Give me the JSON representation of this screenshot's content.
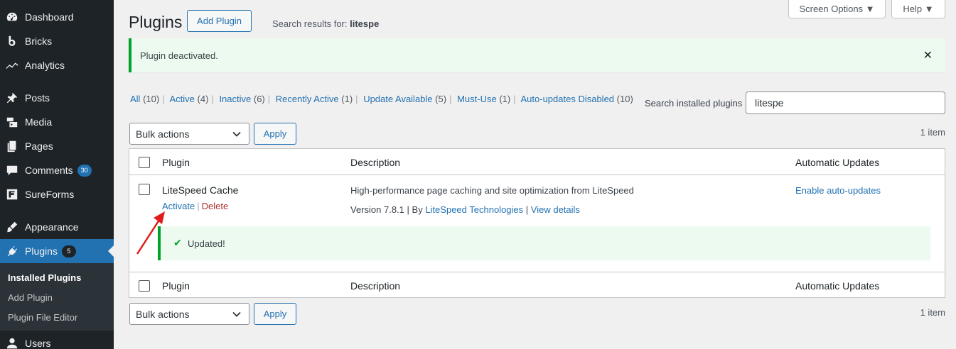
{
  "sidebar": {
    "items": [
      {
        "label": "Dashboard",
        "icon": "dashboard-icon"
      },
      {
        "label": "Bricks",
        "icon": "bricks-icon"
      },
      {
        "label": "Analytics",
        "icon": "analytics-icon"
      },
      {
        "label": "Posts",
        "icon": "pin-icon"
      },
      {
        "label": "Media",
        "icon": "media-icon"
      },
      {
        "label": "Pages",
        "icon": "pages-icon"
      },
      {
        "label": "Comments",
        "icon": "comments-icon",
        "badge": "30"
      },
      {
        "label": "SureForms",
        "icon": "sureforms-icon"
      },
      {
        "label": "Appearance",
        "icon": "brush-icon"
      },
      {
        "label": "Plugins",
        "icon": "plugin-icon",
        "badge": "5"
      },
      {
        "label": "Users",
        "icon": "users-icon"
      }
    ],
    "submenu": [
      "Installed Plugins",
      "Add Plugin",
      "Plugin File Editor"
    ]
  },
  "header": {
    "title": "Plugins",
    "add_button": "Add Plugin",
    "search_prefix": "Search results for:",
    "search_term": "litespe",
    "screen_options": "Screen Options ▼",
    "help": "Help ▼"
  },
  "notice": {
    "message": "Plugin deactivated.",
    "close": "✕"
  },
  "filters": [
    {
      "label": "All",
      "count": "(10)"
    },
    {
      "label": "Active",
      "count": "(4)"
    },
    {
      "label": "Inactive",
      "count": "(6)"
    },
    {
      "label": "Recently Active",
      "count": "(1)"
    },
    {
      "label": "Update Available",
      "count": "(5)"
    },
    {
      "label": "Must-Use",
      "count": "(1)"
    },
    {
      "label": "Auto-updates Disabled",
      "count": "(10)"
    }
  ],
  "search": {
    "label": "Search installed plugins",
    "value": "litespe"
  },
  "bulk": {
    "label": "Bulk actions",
    "apply": "Apply",
    "items_count": "1 item"
  },
  "table": {
    "columns": [
      "Plugin",
      "Description",
      "Automatic Updates"
    ],
    "row": {
      "name": "LiteSpeed Cache",
      "activate": "Activate",
      "delete": "Delete",
      "description": "High-performance page caching and site optimization from LiteSpeed",
      "version": "Version 7.8.1",
      "by": "By",
      "author": "LiteSpeed Technologies",
      "view_details": "View details",
      "auto_updates": "Enable auto-updates",
      "updated": "Updated!"
    }
  },
  "colors": {
    "accent": "#2271b1",
    "success": "#00a32a",
    "sidebar": "#1d2327",
    "danger": "#b32d2e",
    "annotation": "#e01b1b"
  }
}
